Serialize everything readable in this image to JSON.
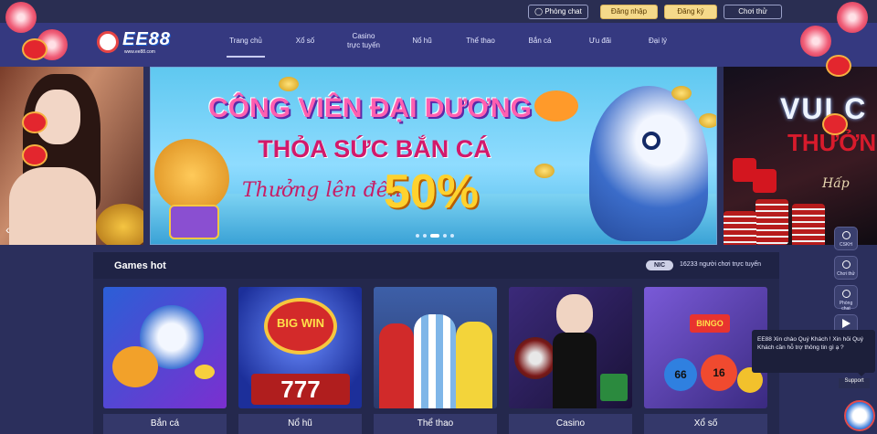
{
  "header": {
    "phong_chat": "Phòng chat",
    "login": "Đăng nhập",
    "register": "Đăng ký",
    "demo": "Chơi thử"
  },
  "logo": {
    "text": "EE88",
    "sub": "www.ee88.com"
  },
  "nav": {
    "items": [
      {
        "label": "Trang chủ"
      },
      {
        "label": "Xổ số"
      },
      {
        "label": "Casino trực tuyến"
      },
      {
        "label": "Nổ hũ"
      },
      {
        "label": "Thể thao"
      },
      {
        "label": "Bắn cá"
      },
      {
        "label": "Ưu đãi"
      },
      {
        "label": "Đại lý"
      }
    ]
  },
  "banner": {
    "title": "CÔNG VIÊN ĐẠI DƯƠNG",
    "subtitle": "THỎA SỨC BẮN CÁ",
    "script": "Thưởng lên đến",
    "percent": "50%"
  },
  "right_banner": {
    "title": "VUI C",
    "title2": "THƯỞN",
    "script": "Hấp"
  },
  "games": {
    "title": "Games hot",
    "online_badge": "NIC",
    "online_text": "16233 người chơi trực tuyến",
    "cards": [
      {
        "label": "Bắn cá"
      },
      {
        "label": "Nổ hũ"
      },
      {
        "label": "Thể thao"
      },
      {
        "label": "Casino"
      },
      {
        "label": "Xổ số"
      }
    ],
    "slot_text": "BIG WIN",
    "slot_digits": "777",
    "bingo_sign": "BINGO",
    "bingo_balls": [
      "66",
      "16"
    ]
  },
  "tools": [
    {
      "label": "CSKH"
    },
    {
      "label": "Chơi thử"
    },
    {
      "label": "Phòng chat"
    },
    {
      "label": ""
    }
  ],
  "chat": {
    "message": "EE88 Xin chào Quý Khách ! Xin hỏi Quý Khách cần hỗ trợ thông tin gì ạ ?",
    "support": "Support"
  }
}
